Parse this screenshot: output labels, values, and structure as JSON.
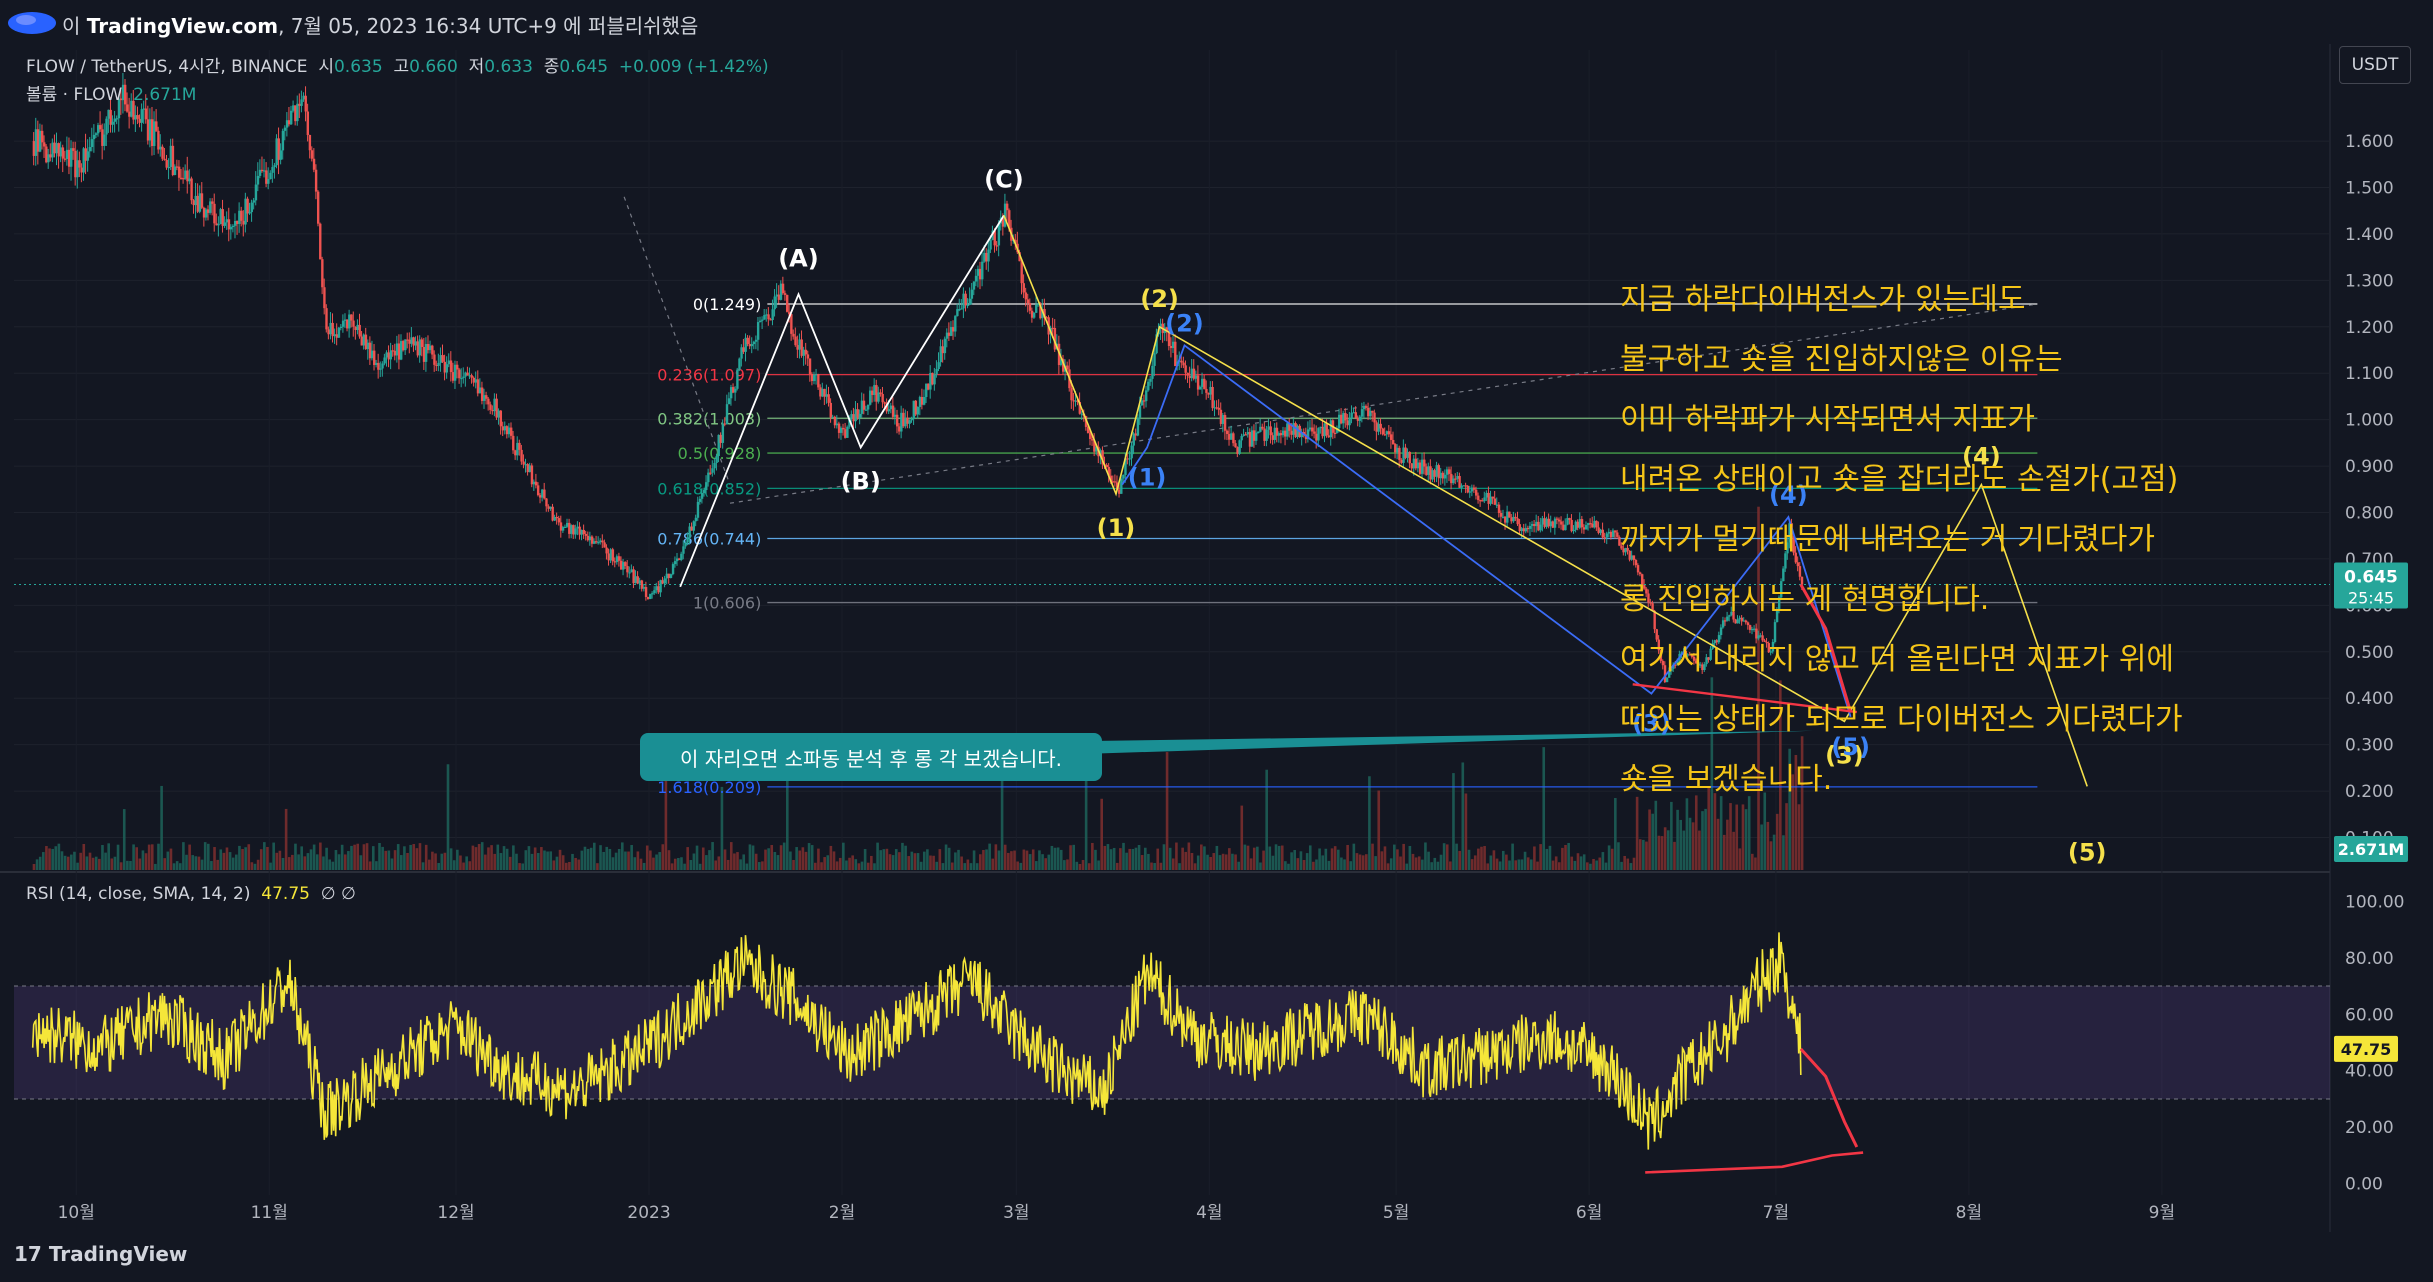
{
  "header": {
    "author_prefix": "이",
    "site": "TradingView.com",
    "date_text": ", 7월 05, 2023 16:34 UTC+9 에 퍼블리쉬했음"
  },
  "legend": {
    "symbol": "FLOW / TetherUS, 4시간, BINANCE",
    "open_label": "시",
    "open": "0.635",
    "high_label": "고",
    "high": "0.660",
    "low_label": "저",
    "low": "0.633",
    "close_label": "종",
    "close": "0.645",
    "change": "+0.009 (+1.42%)"
  },
  "volume_legend": {
    "label": "볼륨 · FLOW",
    "value": "2.671M"
  },
  "rsi_legend": {
    "label": "RSI (14, close, SMA, 14, 2)",
    "value": "47.75",
    "extra": "∅ ∅"
  },
  "currency_button": "USDT",
  "colors": {
    "background": "#131722",
    "up": "#26a69a",
    "down": "#ef5350",
    "rsi": "#f5e639",
    "wave_white": "#ffffff",
    "wave_yellow": "#f5e04b",
    "wave_blue": "#2962ff",
    "annotation_red": "#f23645",
    "note_text": "#f5c518",
    "callout_bg": "#1a8f94"
  },
  "note_lines": [
    "지금 하락다이버전스가 있는데도",
    "불구하고 숏을 진입하지않은 이유는",
    "이미 하락파가 시작되면서 지표가",
    "내려온 상태이고 숏을 잡더라도 손절가(고점)",
    "까지가 멀기때문에 내려오는 거 기다렸다가",
    "롱 진입하시는 게 현명합니다.",
    "여기서 내리지 않고 더 올린다면 지표가 위에",
    "떠있는 상태가 되므로 다이버전스 기다렸다가",
    "숏을 보겠습니다."
  ],
  "callout_text": "이 자리오면 소파동 분석 후 롱 각 보겠습니다.",
  "bottom_logo": "TradingView",
  "chart_data": {
    "type": "line",
    "price_axis": {
      "ticks": [
        1.6,
        1.5,
        1.4,
        1.3,
        1.2,
        1.1,
        1.0,
        0.9,
        0.8,
        0.7,
        0.6,
        0.5,
        0.4,
        0.3,
        0.2,
        0.1
      ],
      "tick_labels": [
        "1.600",
        "1.500",
        "1.400",
        "1.300",
        "1.200",
        "1.100",
        "1.000",
        "0.900",
        "0.800",
        "0.700",
        "0.600",
        "0.500",
        "0.400",
        "0.300",
        "0.200",
        "0.100"
      ],
      "range": [
        0.03,
        1.71
      ]
    },
    "rsi_axis": {
      "ticks": [
        100,
        80,
        60,
        40,
        20,
        0
      ],
      "tick_labels": [
        "100.00",
        "80.00",
        "60.00",
        "40.00",
        "20.00",
        "0.00"
      ],
      "range": [
        -4,
        104
      ],
      "band": [
        30,
        70
      ]
    },
    "time_axis": {
      "labels": [
        "10월",
        "11월",
        "12월",
        "2023",
        "2월",
        "3월",
        "4월",
        "5월",
        "6월",
        "7월",
        "8월",
        "9월"
      ]
    },
    "last_price": "0.645",
    "countdown": "25:45",
    "last_volume": "2.671M",
    "last_rsi": "47.75",
    "price_path": [
      [
        "2022-09-24",
        1.6
      ],
      [
        "2022-10-01",
        1.55
      ],
      [
        "2022-10-05",
        1.62
      ],
      [
        "2022-10-08",
        1.7
      ],
      [
        "2022-10-14",
        1.6
      ],
      [
        "2022-10-20",
        1.48
      ],
      [
        "2022-10-26",
        1.4
      ],
      [
        "2022-11-01",
        1.55
      ],
      [
        "2022-11-06",
        1.7
      ],
      [
        "2022-11-08",
        1.52
      ],
      [
        "2022-11-10",
        1.18
      ],
      [
        "2022-11-14",
        1.22
      ],
      [
        "2022-11-18",
        1.12
      ],
      [
        "2022-11-24",
        1.16
      ],
      [
        "2022-12-01",
        1.1
      ],
      [
        "2022-12-06",
        1.05
      ],
      [
        "2022-12-12",
        0.9
      ],
      [
        "2022-12-17",
        0.78
      ],
      [
        "2022-12-22",
        0.75
      ],
      [
        "2022-12-28",
        0.68
      ],
      [
        "2023-01-01",
        0.62
      ],
      [
        "2023-01-04",
        0.66
      ],
      [
        "2023-01-08",
        0.78
      ],
      [
        "2023-01-12",
        0.95
      ],
      [
        "2023-01-16",
        1.15
      ],
      [
        "2023-01-22",
        1.27
      ],
      [
        "2023-01-26",
        1.12
      ],
      [
        "2023-02-01",
        0.97
      ],
      [
        "2023-02-06",
        1.06
      ],
      [
        "2023-02-10",
        0.99
      ],
      [
        "2023-02-14",
        1.05
      ],
      [
        "2023-02-18",
        1.18
      ],
      [
        "2023-02-22",
        1.3
      ],
      [
        "2023-02-27",
        1.44
      ],
      [
        "2023-03-03",
        1.25
      ],
      [
        "2023-03-06",
        1.2
      ],
      [
        "2023-03-10",
        1.05
      ],
      [
        "2023-03-14",
        0.93
      ],
      [
        "2023-03-17",
        0.84
      ],
      [
        "2023-03-20",
        0.98
      ],
      [
        "2023-03-24",
        1.2
      ],
      [
        "2023-03-27",
        1.12
      ],
      [
        "2023-04-01",
        1.05
      ],
      [
        "2023-04-05",
        0.94
      ],
      [
        "2023-04-09",
        0.97
      ],
      [
        "2023-04-14",
        0.98
      ],
      [
        "2023-04-18",
        0.96
      ],
      [
        "2023-04-22",
        1.0
      ],
      [
        "2023-04-26",
        1.02
      ],
      [
        "2023-05-01",
        0.93
      ],
      [
        "2023-05-06",
        0.89
      ],
      [
        "2023-05-11",
        0.87
      ],
      [
        "2023-05-16",
        0.82
      ],
      [
        "2023-05-21",
        0.76
      ],
      [
        "2023-05-26",
        0.78
      ],
      [
        "2023-06-01",
        0.77
      ],
      [
        "2023-06-05",
        0.75
      ],
      [
        "2023-06-08",
        0.7
      ],
      [
        "2023-06-11",
        0.58
      ],
      [
        "2023-06-13",
        0.44
      ],
      [
        "2023-06-16",
        0.5
      ],
      [
        "2023-06-19",
        0.46
      ],
      [
        "2023-06-23",
        0.58
      ],
      [
        "2023-06-27",
        0.55
      ],
      [
        "2023-06-30",
        0.5
      ],
      [
        "2023-07-02",
        0.68
      ],
      [
        "2023-07-03",
        0.77
      ],
      [
        "2023-07-04",
        0.7
      ],
      [
        "2023-07-05",
        0.645
      ]
    ],
    "fibonacci": [
      {
        "label": "0(1.249)",
        "value": 1.249,
        "color": "#ffffff"
      },
      {
        "label": "0.236(1.097)",
        "value": 1.097,
        "color": "#f23645"
      },
      {
        "label": "0.382(1.003)",
        "value": 1.003,
        "color": "#81c784"
      },
      {
        "label": "0.5(0.928)",
        "value": 0.928,
        "color": "#4caf50"
      },
      {
        "label": "0.618(0.852)",
        "value": 0.852,
        "color": "#089981"
      },
      {
        "label": "0.786(0.744)",
        "value": 0.744,
        "color": "#64b5f6"
      },
      {
        "label": "1(0.606)",
        "value": 0.606,
        "color": "#787b86"
      },
      {
        "label": "1.618(0.209)",
        "value": 0.209,
        "color": "#2962ff"
      }
    ],
    "wave_white": [
      {
        "label": "(A)",
        "date": "2023-01-25",
        "value": 1.27
      },
      {
        "label": "(B)",
        "date": "2023-02-04",
        "value": 0.94
      },
      {
        "label": "(C)",
        "date": "2023-02-27",
        "value": 1.44
      }
    ],
    "wave_yellow": [
      {
        "label": "(2)",
        "date": "2023-03-24",
        "value": 1.2
      },
      {
        "label": "(1)",
        "date": "2023-03-17",
        "value": 0.84
      },
      {
        "label": "(3)",
        "date": "2023-07-12",
        "value": 0.35
      },
      {
        "label": "(4)",
        "date": "2023-08-03",
        "value": 0.86
      },
      {
        "label": "(5)",
        "date": "2023-08-20",
        "value": 0.21
      }
    ],
    "wave_blue": [
      {
        "label": "(1)",
        "date": "2023-03-22",
        "value": 0.94
      },
      {
        "label": "(2)",
        "date": "2023-03-28",
        "value": 1.16
      },
      {
        "label": "(3)",
        "date": "2023-06-11",
        "value": 0.41
      },
      {
        "label": "(4)",
        "date": "2023-07-03",
        "value": 0.79
      },
      {
        "label": "(5)",
        "date": "2023-07-13",
        "value": 0.36
      }
    ],
    "rsi_path": [
      [
        "2022-09-24",
        55
      ],
      [
        "2022-10-05",
        48
      ],
      [
        "2022-10-15",
        60
      ],
      [
        "2022-10-25",
        44
      ],
      [
        "2022-11-04",
        72
      ],
      [
        "2022-11-10",
        25
      ],
      [
        "2022-11-20",
        40
      ],
      [
        "2022-12-01",
        56
      ],
      [
        "2022-12-10",
        38
      ],
      [
        "2022-12-20",
        33
      ],
      [
        "2022-12-30",
        45
      ],
      [
        "2023-01-08",
        62
      ],
      [
        "2023-01-16",
        78
      ],
      [
        "2023-01-24",
        66
      ],
      [
        "2023-02-02",
        45
      ],
      [
        "2023-02-12",
        58
      ],
      [
        "2023-02-22",
        72
      ],
      [
        "2023-02-28",
        55
      ],
      [
        "2023-03-08",
        40
      ],
      [
        "2023-03-15",
        32
      ],
      [
        "2023-03-22",
        74
      ],
      [
        "2023-03-30",
        52
      ],
      [
        "2023-04-08",
        47
      ],
      [
        "2023-04-18",
        55
      ],
      [
        "2023-04-26",
        60
      ],
      [
        "2023-05-06",
        40
      ],
      [
        "2023-05-16",
        46
      ],
      [
        "2023-05-26",
        52
      ],
      [
        "2023-06-04",
        42
      ],
      [
        "2023-06-11",
        20
      ],
      [
        "2023-06-16",
        38
      ],
      [
        "2023-06-22",
        50
      ],
      [
        "2023-06-28",
        70
      ],
      [
        "2023-07-02",
        80
      ],
      [
        "2023-07-05",
        47.75
      ]
    ],
    "rsi_projection": [
      [
        "2023-07-05",
        47.75
      ],
      [
        "2023-07-09",
        38
      ],
      [
        "2023-07-12",
        22
      ],
      [
        "2023-07-14",
        13
      ]
    ],
    "rsi_divergence_line": [
      [
        "2023-06-10",
        4
      ],
      [
        "2023-07-02",
        6
      ],
      [
        "2023-07-10",
        10
      ],
      [
        "2023-07-15",
        11
      ]
    ],
    "price_projection": [
      [
        "2023-07-05",
        0.645
      ],
      [
        "2023-07-09",
        0.55
      ],
      [
        "2023-07-13",
        0.37
      ]
    ],
    "price_red_line": [
      [
        "2023-06-08",
        0.43
      ],
      [
        "2023-07-14",
        0.37
      ]
    ],
    "callout_pointer": {
      "date": "2023-07-07",
      "value": 0.33
    }
  }
}
